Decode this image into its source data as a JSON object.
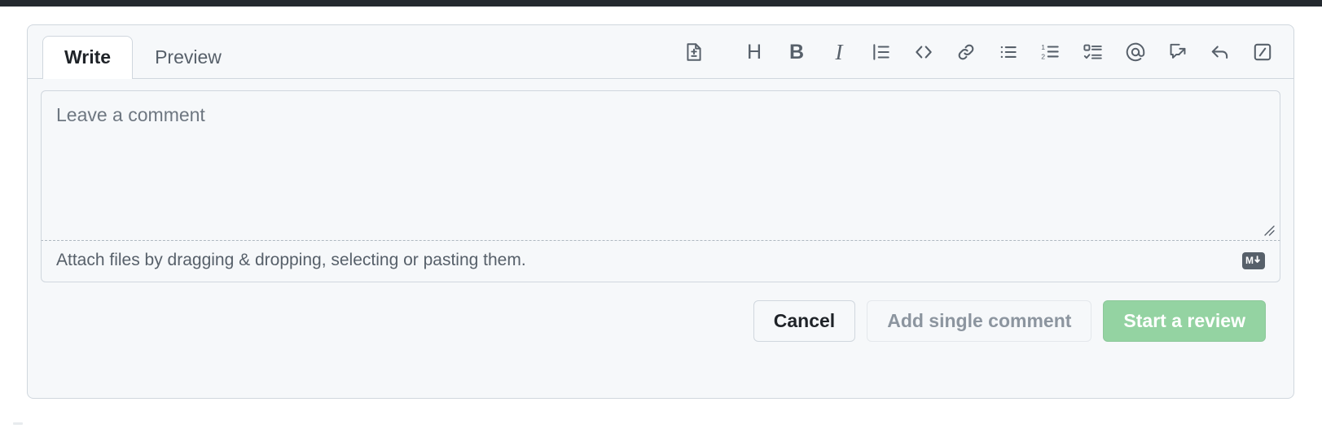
{
  "theme": {
    "topbar_color": "#24292f",
    "surface": "#f6f8fa",
    "border": "#d0d7de",
    "text_primary": "#1f2328",
    "text_muted": "#57606a",
    "text_disabled": "#8c959f",
    "primary_disabled_green": "#94d3a2",
    "markdown_badge_bg": "#57606a"
  },
  "composer": {
    "tabs": [
      {
        "label": "Write",
        "active": true
      },
      {
        "label": "Preview",
        "active": false
      }
    ],
    "toolbar": {
      "items": [
        {
          "icon": "suggested-change-icon",
          "tooltip": "Add a suggestion"
        },
        {
          "icon": "heading-icon",
          "glyph": "H"
        },
        {
          "icon": "bold-icon",
          "glyph": "B"
        },
        {
          "icon": "italic-icon",
          "glyph": "I"
        },
        {
          "icon": "quote-icon"
        },
        {
          "icon": "code-icon",
          "glyph": "<>"
        },
        {
          "icon": "link-icon"
        },
        {
          "icon": "unordered-list-icon"
        },
        {
          "icon": "ordered-list-icon"
        },
        {
          "icon": "task-list-icon"
        },
        {
          "icon": "mention-icon",
          "glyph": "@"
        },
        {
          "icon": "saved-reply-icon"
        },
        {
          "icon": "reply-icon"
        },
        {
          "icon": "slash-command-icon"
        }
      ]
    },
    "textarea": {
      "value": "",
      "placeholder": "Leave a comment"
    },
    "attach": {
      "hint": "Attach files by dragging & dropping, selecting or pasting them.",
      "markdown_badge": "M"
    },
    "actions": {
      "cancel_label": "Cancel",
      "add_single_comment_label": "Add single comment",
      "start_review_label": "Start a review"
    }
  }
}
